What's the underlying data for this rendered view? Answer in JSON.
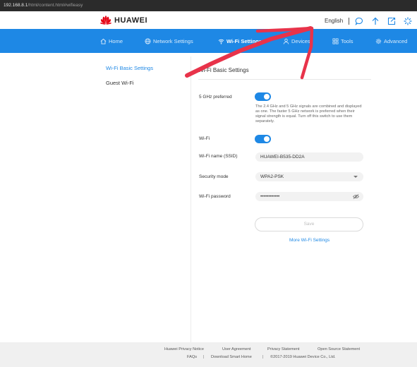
{
  "browser": {
    "url_host": "192.168.8.1",
    "url_path": "/html/content.html#wifieasy"
  },
  "brand": {
    "name": "HUAWEI"
  },
  "topbar": {
    "language": "English",
    "icons": [
      "message-icon",
      "upload-icon",
      "logout-icon",
      "loading-icon"
    ]
  },
  "nav": {
    "items": [
      {
        "label": "Home",
        "icon": "home-icon"
      },
      {
        "label": "Network Settings",
        "icon": "globe-icon"
      },
      {
        "label": "Wi-Fi Settings",
        "icon": "wifi-icon",
        "active": true
      },
      {
        "label": "Devices",
        "icon": "user-icon"
      },
      {
        "label": "Tools",
        "icon": "grid-icon"
      },
      {
        "label": "Advanced",
        "icon": "gear-icon"
      }
    ]
  },
  "sidebar": {
    "items": [
      {
        "label": "Wi-Fi Basic Settings",
        "active": true
      },
      {
        "label": "Guest Wi-Fi"
      }
    ]
  },
  "main": {
    "title": "Wi-Fi Basic Settings",
    "five_ghz_label": "5 GHz preferred",
    "five_ghz_on": true,
    "five_ghz_desc": "The 2.4 GHz and 5 GHz signals are combined and displayed as one. The faster 5 GHz network is preferred when their signal strength is equal. Turn off this switch to use them separately.",
    "wifi_label": "Wi-Fi",
    "wifi_on": true,
    "ssid_label": "Wi-Fi name (SSID)",
    "ssid_value": "HUAWEI-B535-DD2A",
    "security_label": "Security mode",
    "security_value": "WPA2-PSK",
    "password_label": "Wi-Fi password",
    "password_value": "••••••••••••",
    "save_label": "Save",
    "more_link": "More Wi-Fi Settings"
  },
  "footer": {
    "links_row1": [
      "Huawei Privacy Notice",
      "User Agreement",
      "Privacy Statement",
      "Open Source Statement"
    ],
    "links_row2": [
      "FAQs",
      "Download Smart Home"
    ],
    "copyright": "©2017-2019 Huawei Device Co., Ltd."
  },
  "colors": {
    "accent": "#1e88e5",
    "annotation": "#e8334a"
  }
}
